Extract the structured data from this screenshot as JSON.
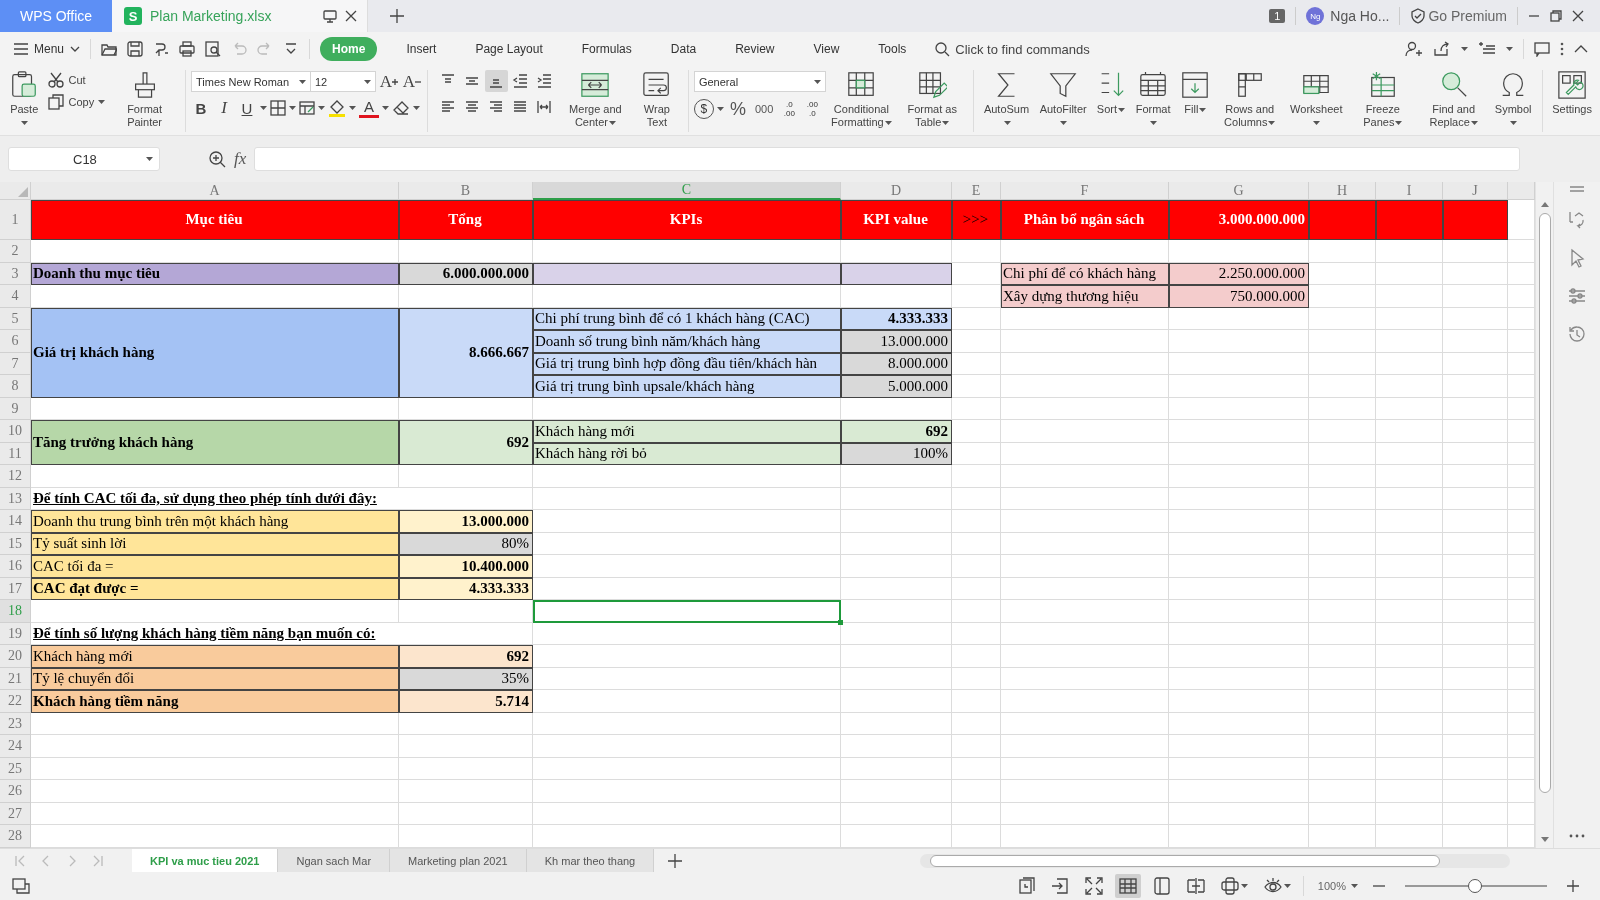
{
  "title_bar": {
    "app_tab": "WPS Office",
    "document": {
      "badge": "S",
      "name": "Plan Marketing.xlsx"
    },
    "window_count": "1",
    "user": {
      "initials": "Ng",
      "name": "Nga Ho..."
    },
    "premium": "Go Premium"
  },
  "menu_bar": {
    "menu": "Menu",
    "tabs": [
      {
        "label": "Home",
        "selected": true
      },
      {
        "label": "Insert",
        "selected": false
      },
      {
        "label": "Page Layout",
        "selected": false
      },
      {
        "label": "Formulas",
        "selected": false
      },
      {
        "label": "Data",
        "selected": false
      },
      {
        "label": "Review",
        "selected": false
      },
      {
        "label": "View",
        "selected": false
      },
      {
        "label": "Tools",
        "selected": false
      }
    ],
    "search": {
      "placeholder": "Click to find commands"
    }
  },
  "ribbon": [
    {
      "kind": "large",
      "label": "Paste",
      "dropdown": true
    },
    {
      "kind": "stack",
      "items": [
        {
          "label": "Cut",
          "dropdown": false
        },
        {
          "label": "Copy",
          "dropdown": true
        }
      ]
    },
    {
      "kind": "large",
      "label": "Format Painter",
      "dropdown": false
    },
    {
      "kind": "separator"
    },
    {
      "kind": "font",
      "font": "Times New Roman",
      "size": "12",
      "grow": "A",
      "shrink": "A",
      "styles": [
        "B",
        "I",
        "U"
      ],
      "font_color": "A"
    },
    {
      "kind": "separator"
    },
    {
      "kind": "alignment",
      "buttons": [
        {
          "selected": false
        },
        {
          "selected": false
        },
        {
          "selected": true
        },
        {
          "selected": false
        },
        {
          "selected": false
        },
        {
          "selected": false
        },
        {
          "selected": false
        },
        {
          "selected": false
        },
        {
          "selected": false
        },
        {
          "selected": false
        }
      ]
    },
    {
      "kind": "large",
      "label": "Merge and Center",
      "dropdown": true
    },
    {
      "kind": "large",
      "label": "Wrap Text",
      "dropdown": false
    },
    {
      "kind": "separator"
    },
    {
      "kind": "number",
      "format": "General",
      "currency": "$",
      "percent": "%",
      "thousands": "000",
      "decimals": [
        {
          "lines": [
            ".0",
            ".00"
          ]
        },
        {
          "lines": [
            ".00",
            ".0"
          ]
        }
      ]
    },
    {
      "kind": "large",
      "label": "Conditional Formatting",
      "dropdown": true
    },
    {
      "kind": "large",
      "label": "Format as Table",
      "dropdown": true
    },
    {
      "kind": "separator"
    },
    {
      "kind": "large",
      "label": "AutoSum",
      "dropdown": true
    },
    {
      "kind": "large",
      "label": "AutoFilter",
      "dropdown": true
    },
    {
      "kind": "large",
      "label": "Sort",
      "dropdown": true
    },
    {
      "kind": "large",
      "label": "Format",
      "dropdown": true
    },
    {
      "kind": "large",
      "label": "Fill",
      "dropdown": true
    },
    {
      "kind": "large",
      "label": "Rows and Columns",
      "dropdown": true
    },
    {
      "kind": "large",
      "label": "Worksheet",
      "dropdown": true
    },
    {
      "kind": "large",
      "label": "Freeze Panes",
      "dropdown": true
    },
    {
      "kind": "large",
      "label": "Find and Replace",
      "dropdown": true
    },
    {
      "kind": "large",
      "label": "Symbol",
      "dropdown": true
    },
    {
      "kind": "separator"
    },
    {
      "kind": "large",
      "label": "Settings",
      "dropdown": false
    }
  ],
  "formula_bar": {
    "cell_name": "C18",
    "function_label": "fx"
  },
  "sheet": {
    "columns": [
      {
        "label": "A",
        "selected": false
      },
      {
        "label": "B",
        "selected": false
      },
      {
        "label": "C",
        "selected": true
      },
      {
        "label": "D",
        "selected": false
      },
      {
        "label": "E",
        "selected": false
      },
      {
        "label": "F",
        "selected": false
      },
      {
        "label": "G",
        "selected": false
      },
      {
        "label": "H",
        "selected": false
      },
      {
        "label": "I",
        "selected": false
      },
      {
        "label": "J",
        "selected": false
      }
    ],
    "rows": [
      {
        "number": "1",
        "selected": false,
        "cells": [
          {
            "kind": "header",
            "text": "Mục tiêu",
            "color": "#ff0000",
            "bold": true,
            "underline": false
          },
          {
            "kind": "header",
            "text": "Tổng",
            "color": "#ff0000",
            "bold": true,
            "underline": false
          },
          {
            "kind": "header",
            "text": "KPIs",
            "color": "#ff0000",
            "bold": true,
            "underline": false
          },
          {
            "kind": "header",
            "text": "KPI value",
            "color": "#ff0000",
            "bold": true,
            "underline": false
          },
          {
            "kind": "marker",
            "text": ">>>",
            "color": "#ff0000",
            "bold": false,
            "underline": false
          },
          {
            "kind": "header",
            "text": "Phân bổ ngân sách",
            "color": "#ff0000",
            "bold": true,
            "underline": false
          },
          {
            "kind": "header-number",
            "text": "3.000.000.000",
            "color": "#ff0000",
            "bold": true,
            "underline": false
          },
          {
            "kind": "fill",
            "color": "#ff0000"
          },
          {
            "kind": "fill",
            "color": "#ff0000"
          },
          {
            "kind": "fill",
            "color": "#ff0000"
          }
        ]
      },
      {
        "number": "2",
        "selected": false
      },
      {
        "number": "3",
        "selected": false,
        "cells": [
          {
            "kind": "text",
            "text": "Doanh thu mục tiêu",
            "color": "#b4a7d6",
            "bold": true,
            "underline": false
          },
          {
            "kind": "number",
            "text": "6.000.000.000",
            "color": "#d9d9d9",
            "bold": true,
            "underline": false
          },
          {
            "kind": "fill",
            "color": "#d9d2e9"
          },
          {
            "kind": "fill",
            "color": "#d9d2e9"
          },
          {
            "kind": "blank"
          },
          {
            "kind": "text",
            "text": "Chi phí để có khách hàng",
            "color": "#f4cccc",
            "bold": false,
            "underline": false
          },
          {
            "kind": "number",
            "text": "2.250.000.000",
            "color": "#f4cccc",
            "bold": false,
            "underline": false
          }
        ]
      },
      {
        "number": "4",
        "selected": false,
        "cells": [
          {
            "kind": "blank"
          },
          {
            "kind": "blank"
          },
          {
            "kind": "blank"
          },
          {
            "kind": "blank"
          },
          {
            "kind": "blank"
          },
          {
            "kind": "text",
            "text": "Xây dựng thương hiệu",
            "color": "#f4cccc",
            "bold": false,
            "underline": false
          },
          {
            "kind": "number",
            "text": "750.000.000",
            "color": "#f4cccc",
            "bold": false,
            "underline": false
          }
        ]
      },
      {
        "number": "5",
        "selected": false,
        "cells": [
          {
            "kind": "text",
            "text": "Giá trị khách hàng",
            "color": "#a4c2f4",
            "bold": true,
            "underline": false
          },
          {
            "kind": "number",
            "text": "8.666.667",
            "color": "#c9daf8",
            "bold": true,
            "underline": false
          },
          {
            "kind": "text",
            "text": "Chi phí trung bình để có 1 khách hàng (CAC)",
            "color": "#c9daf8",
            "bold": false,
            "underline": false
          },
          {
            "kind": "number",
            "text": "4.333.333",
            "color": "#c9daf8",
            "bold": true,
            "underline": false
          }
        ]
      },
      {
        "number": "6",
        "selected": false,
        "cells": [
          {
            "kind": "covered-above"
          },
          {
            "kind": "covered-above"
          },
          {
            "kind": "text",
            "text": "Doanh số trung bình năm/khách hàng",
            "color": "#c9daf8",
            "bold": false,
            "underline": false
          },
          {
            "kind": "number",
            "text": "13.000.000",
            "color": "#d9d9d9",
            "bold": false,
            "underline": false
          }
        ]
      },
      {
        "number": "7",
        "selected": false,
        "cells": [
          {
            "kind": "covered-above"
          },
          {
            "kind": "covered-above"
          },
          {
            "kind": "text",
            "text": "Giá trị trung bình hợp đồng đầu tiên/khách hàn",
            "color": "#c9daf8",
            "bold": false,
            "underline": false
          },
          {
            "kind": "number",
            "text": "8.000.000",
            "color": "#d9d9d9",
            "bold": false,
            "underline": false
          }
        ]
      },
      {
        "number": "8",
        "selected": false,
        "cells": [
          {
            "kind": "covered-above"
          },
          {
            "kind": "covered-above"
          },
          {
            "kind": "text",
            "text": "Giá trị trung bình upsale/khách hàng",
            "color": "#c9daf8",
            "bold": false,
            "underline": false
          },
          {
            "kind": "number",
            "text": "5.000.000",
            "color": "#d9d9d9",
            "bold": false,
            "underline": false
          }
        ]
      },
      {
        "number": "9",
        "selected": false
      },
      {
        "number": "10",
        "selected": false,
        "cells": [
          {
            "kind": "text",
            "text": "Tăng trưởng khách hàng",
            "color": "#b6d7a8",
            "bold": true,
            "underline": false
          },
          {
            "kind": "number",
            "text": "692",
            "color": "#d9ead3",
            "bold": true,
            "underline": false
          },
          {
            "kind": "text",
            "text": "Khách hàng mới",
            "color": "#d9ead3",
            "bold": false,
            "underline": false
          },
          {
            "kind": "number",
            "text": "692",
            "color": "#d9ead3",
            "bold": true,
            "underline": false
          }
        ]
      },
      {
        "number": "11",
        "selected": false,
        "cells": [
          {
            "kind": "covered-above"
          },
          {
            "kind": "covered-above"
          },
          {
            "kind": "text",
            "text": "Khách hàng rời bỏ",
            "color": "#d9ead3",
            "bold": false,
            "underline": false
          },
          {
            "kind": "number",
            "text": "100%",
            "color": "#d9d9d9",
            "bold": false,
            "underline": false
          }
        ]
      },
      {
        "number": "12",
        "selected": false
      },
      {
        "number": "13",
        "selected": false,
        "cells": [
          {
            "kind": "text",
            "text": "Để tính CAC tối đa, sử dụng theo phép tính dưới đây:",
            "bold": true,
            "underline": true
          },
          {
            "kind": "covered-left"
          }
        ]
      },
      {
        "number": "14",
        "selected": false,
        "cells": [
          {
            "kind": "text",
            "text": "Doanh thu trung bình trên một khách hàng",
            "color": "#ffe599",
            "bold": false,
            "underline": false
          },
          {
            "kind": "number",
            "text": "13.000.000",
            "color": "#fff2cc",
            "bold": true,
            "underline": false
          }
        ]
      },
      {
        "number": "15",
        "selected": false,
        "cells": [
          {
            "kind": "text",
            "text": "Tỷ suất sinh lời",
            "color": "#ffe599",
            "bold": false,
            "underline": false
          },
          {
            "kind": "number",
            "text": "80%",
            "color": "#d9d9d9",
            "bold": false,
            "underline": false
          }
        ]
      },
      {
        "number": "16",
        "selected": false,
        "cells": [
          {
            "kind": "text",
            "text": "CAC tối đa =",
            "color": "#ffe599",
            "bold": false,
            "underline": false
          },
          {
            "kind": "number",
            "text": "10.400.000",
            "color": "#fff2cc",
            "bold": true,
            "underline": false
          }
        ]
      },
      {
        "number": "17",
        "selected": false,
        "cells": [
          {
            "kind": "text",
            "text": "CAC đạt được =",
            "color": "#ffe599",
            "bold": true,
            "underline": false
          },
          {
            "kind": "number",
            "text": "4.333.333",
            "color": "#fff2cc",
            "bold": true,
            "underline": false
          }
        ]
      },
      {
        "number": "18",
        "selected": true
      },
      {
        "number": "19",
        "selected": false,
        "cells": [
          {
            "kind": "text",
            "text": "Để tính số lượng khách hàng tiềm năng bạn muốn có:",
            "bold": true,
            "underline": true
          },
          {
            "kind": "covered-left"
          }
        ]
      },
      {
        "number": "20",
        "selected": false,
        "cells": [
          {
            "kind": "text",
            "text": "Khách hàng mới",
            "color": "#f9cb9c",
            "bold": false,
            "underline": false
          },
          {
            "kind": "number",
            "text": "692",
            "color": "#fce5cd",
            "bold": true,
            "underline": false
          }
        ]
      },
      {
        "number": "21",
        "selected": false,
        "cells": [
          {
            "kind": "text",
            "text": "Tỷ lệ chuyển đổi",
            "color": "#f9cb9c",
            "bold": false,
            "underline": false
          },
          {
            "kind": "number",
            "text": "35%",
            "color": "#d9d9d9",
            "bold": false,
            "underline": false
          }
        ]
      },
      {
        "number": "22",
        "selected": false,
        "cells": [
          {
            "kind": "text",
            "text": "Khách hàng tiềm năng",
            "color": "#f9cb9c",
            "bold": true,
            "underline": false
          },
          {
            "kind": "number",
            "text": "5.714",
            "color": "#fce5cd",
            "bold": true,
            "underline": false
          }
        ]
      },
      {
        "number": "23",
        "selected": false
      },
      {
        "number": "24",
        "selected": false
      },
      {
        "number": "25",
        "selected": false
      },
      {
        "number": "26",
        "selected": false
      },
      {
        "number": "27",
        "selected": false
      },
      {
        "number": "28",
        "selected": false
      }
    ]
  },
  "sheet_tabs": [
    {
      "label": "KPI va muc tieu 2021",
      "selected": true
    },
    {
      "label": "Ngan sach Mar",
      "selected": false
    },
    {
      "label": "Marketing plan 2021",
      "selected": false
    },
    {
      "label": "Kh mar theo thang",
      "selected": false
    }
  ],
  "status_bar": {
    "view_buttons": [
      {
        "selected": false
      },
      {
        "selected": false
      },
      {
        "selected": false
      },
      {
        "selected": true
      },
      {
        "selected": false
      },
      {
        "selected": false
      },
      {
        "selected": false
      },
      {
        "selected": false
      }
    ],
    "zoom": "100%",
    "zoom_slider": {
      "level": 0.49
    }
  }
}
